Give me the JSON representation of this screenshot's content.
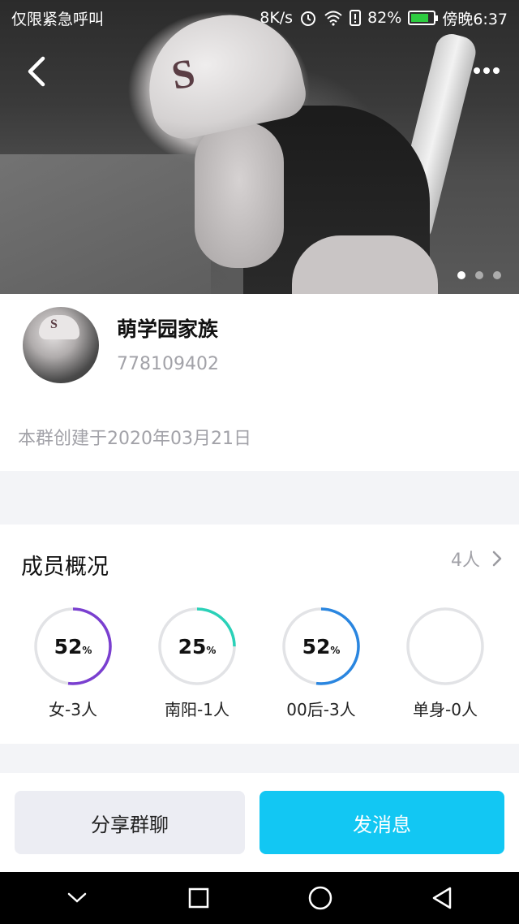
{
  "status_bar": {
    "carrier": "仅限紧急呼叫",
    "speed": "8K/s",
    "battery_percent": "82%",
    "battery_level": 0.82,
    "time": "傍晚6:37"
  },
  "carousel": {
    "page_count": 3,
    "active_index": 0
  },
  "group": {
    "name": "萌学园家族",
    "id": "778109402",
    "created": "本群创建于2020年03月21日"
  },
  "members": {
    "title": "成员概况",
    "count": "4人",
    "stats": [
      {
        "value": "52",
        "unit": "%",
        "label": "女-3人",
        "fraction": 0.52,
        "color": "#7a3fd0"
      },
      {
        "value": "25",
        "unit": "%",
        "label": "南阳-1人",
        "fraction": 0.25,
        "color": "#2ad1b8"
      },
      {
        "value": "52",
        "unit": "%",
        "label": "00后-3人",
        "fraction": 0.52,
        "color": "#2a86e0"
      },
      {
        "value": "",
        "unit": "",
        "label": "单身-0人",
        "fraction": 0,
        "color": "#dddddd"
      }
    ]
  },
  "actions": {
    "share_label": "分享群聊",
    "send_label": "发消息"
  },
  "colors": {
    "accent": "#12c7f3",
    "ring_track": "#e2e3e6",
    "muted_text": "#a2a2a8"
  }
}
